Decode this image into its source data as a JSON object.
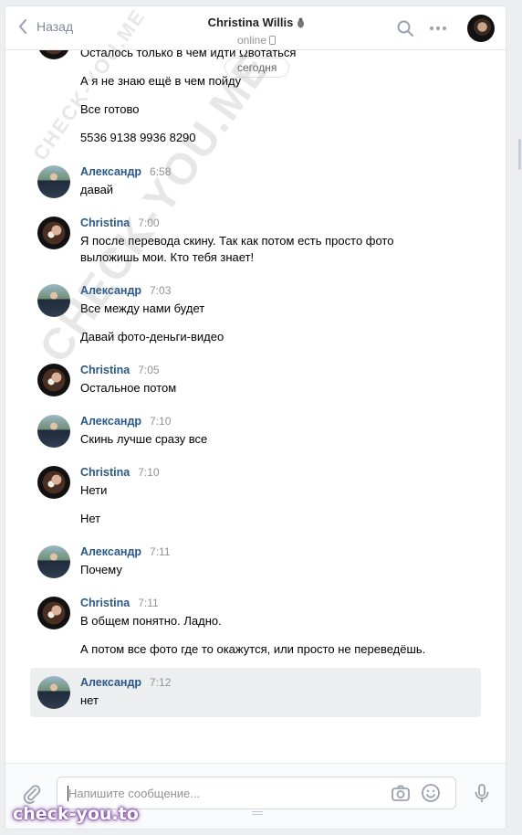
{
  "header": {
    "back_label": "Назад",
    "title": "Christina Willis",
    "status": "online"
  },
  "date_separator": "сегодня",
  "messages": [
    {
      "author": "",
      "time": "",
      "texts": [
        "Осталось только в чем идти Ωвотаться",
        "А я не знаю ещё в чем пойду",
        "Все готово",
        "5536 9138 9936 8290"
      ]
    },
    {
      "author": "Александр",
      "time": "6:58",
      "texts": [
        "давай"
      ]
    },
    {
      "author": "Christina",
      "time": "7:00",
      "texts": [
        "Я после перевода скину. Так как потом есть просто фото выложишь мои. Кто тебя знает!"
      ]
    },
    {
      "author": "Александр",
      "time": "7:03",
      "texts": [
        "Все между нами будет",
        "Давай фото-деньги-видео"
      ]
    },
    {
      "author": "Christina",
      "time": "7:05",
      "texts": [
        "Остальное потом"
      ]
    },
    {
      "author": "Александр",
      "time": "7:10",
      "texts": [
        "Скинь лучше сразу все"
      ]
    },
    {
      "author": "Christina",
      "time": "7:10",
      "texts": [
        "Нети",
        "Нет"
      ]
    },
    {
      "author": "Александр",
      "time": "7:11",
      "texts": [
        "Почему"
      ]
    },
    {
      "author": "Christina",
      "time": "7:11",
      "texts": [
        "В общем понятно. Ладно.",
        "А потом все фото где то окажутся, или просто не переведёшь."
      ]
    },
    {
      "author": "Александр",
      "time": "7:12",
      "texts": [
        "нет"
      ]
    }
  ],
  "composer": {
    "placeholder": "Напишите сообщение..."
  },
  "watermarks": {
    "diagonal": "CHECK-YOU.ME",
    "bottom": "check-you.to"
  },
  "colors": {
    "author": "#2a5885",
    "accent": "#5181b8"
  }
}
